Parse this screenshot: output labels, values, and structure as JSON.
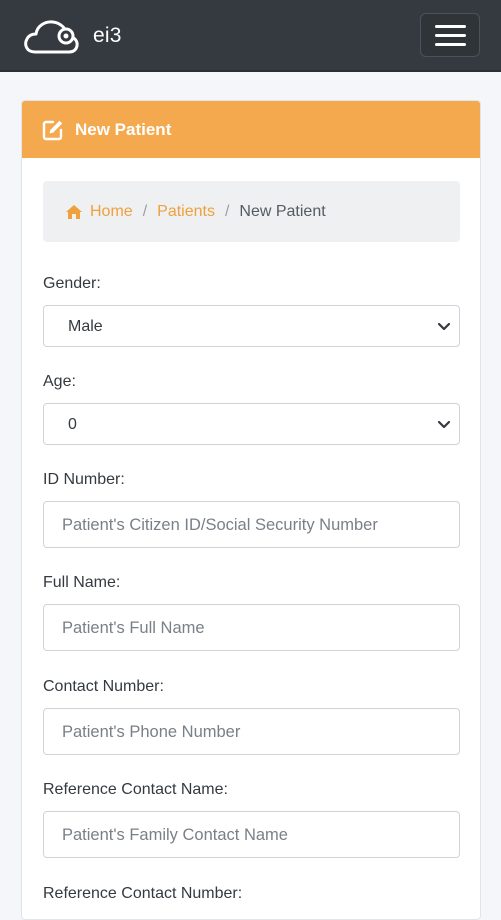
{
  "app": {
    "title": "ei3"
  },
  "header": {
    "logo_icon": "cloud-icon",
    "menu_icon": "hamburger-menu-icon"
  },
  "card": {
    "title": "New Patient",
    "icon": "edit-icon",
    "accent_color": "#f5a94f"
  },
  "breadcrumb": {
    "home": "Home",
    "patients": "Patients",
    "current": "New Patient",
    "separator": "/"
  },
  "form": {
    "gender": {
      "label": "Gender:",
      "value": "Male"
    },
    "age": {
      "label": "Age:",
      "value": "0"
    },
    "id_number": {
      "label": "ID Number:",
      "placeholder": "Patient's Citizen ID/Social Security Number"
    },
    "full_name": {
      "label": "Full Name:",
      "placeholder": "Patient's Full Name"
    },
    "contact_number": {
      "label": "Contact Number:",
      "placeholder": "Patient's Phone Number"
    },
    "reference_contact_name": {
      "label": "Reference Contact Name:",
      "placeholder": "Patient's Family Contact Name"
    },
    "reference_contact_number": {
      "label": "Reference Contact Number:"
    }
  }
}
